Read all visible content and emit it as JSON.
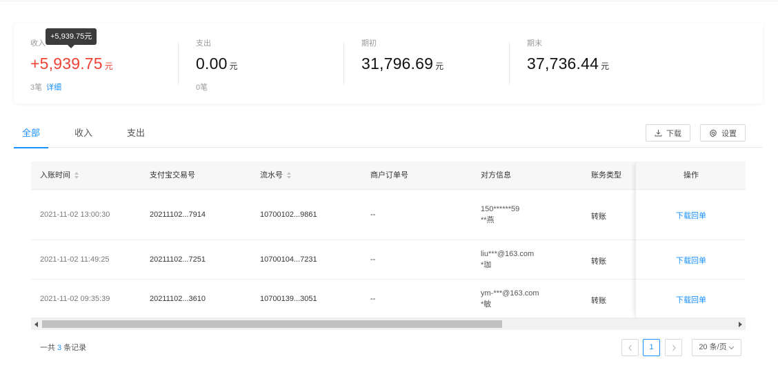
{
  "summary": {
    "income": {
      "label": "收入",
      "value": "+5,939.75",
      "unit": "元",
      "count": "3笔",
      "detail_link": "详细"
    },
    "expense": {
      "label": "支出",
      "value": "0.00",
      "unit": "元",
      "count": "0笔"
    },
    "opening": {
      "label": "期初",
      "value": "31,796.69",
      "unit": "元"
    },
    "closing": {
      "label": "期末",
      "value": "37,736.44",
      "unit": "元"
    },
    "tooltip": "+5,939.75元"
  },
  "tabs": [
    "全部",
    "收入",
    "支出"
  ],
  "actions": {
    "download": "下载",
    "settings": "设置"
  },
  "table": {
    "columns": [
      "入账时间",
      "支付宝交易号",
      "流水号",
      "商户订单号",
      "对方信息",
      "账务类型",
      "操作"
    ],
    "rows": [
      {
        "time": "2021-11-02 13:00:30",
        "trade_no": "20211102...7914",
        "serial_no": "10700102...9861",
        "order_no": "--",
        "cp_account": "150******59",
        "cp_name": "**燕",
        "type": "转账",
        "action": "下载回单"
      },
      {
        "time": "2021-11-02 11:49:25",
        "trade_no": "20211102...7251",
        "serial_no": "10700104...7231",
        "order_no": "--",
        "cp_account": "liu***@163.com",
        "cp_name": "*珈",
        "type": "转账",
        "action": "下载回单"
      },
      {
        "time": "2021-11-02 09:35:39",
        "trade_no": "20211102...3610",
        "serial_no": "10700139...3051",
        "order_no": "--",
        "cp_account": "ym-***@163.com",
        "cp_name": "*敏",
        "type": "转账",
        "action": "下载回单"
      }
    ]
  },
  "footer": {
    "total_prefix": "一共",
    "total_count": "3",
    "total_suffix": "条记录",
    "current_page": "1",
    "page_size": "20 条/页"
  },
  "colors": {
    "accent": "#1890ff",
    "income": "#f04134"
  },
  "icons": {
    "download": "download-icon",
    "settings": "gear-icon",
    "sort": "sort-icon",
    "prev": "chevron-left-icon",
    "next": "chevron-right-icon",
    "dropdown": "chevron-down-icon"
  }
}
